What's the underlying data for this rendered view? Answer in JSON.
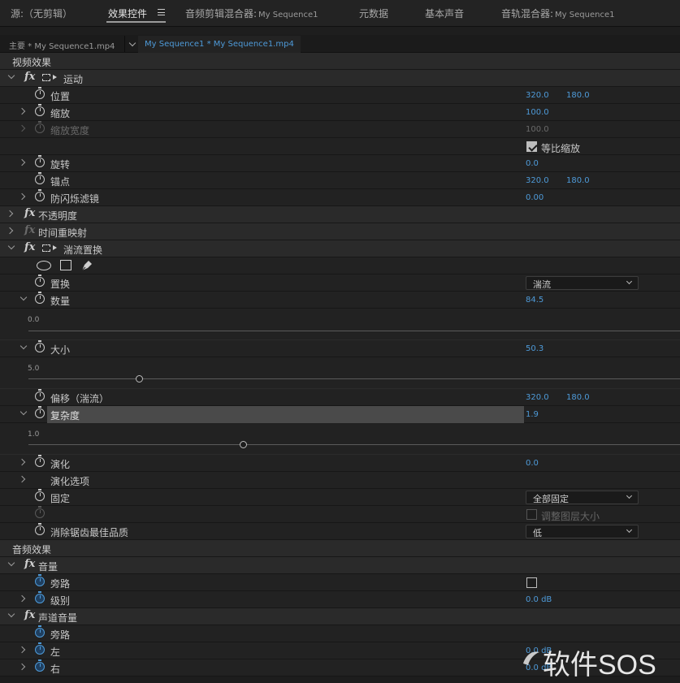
{
  "top_tabs": [
    {
      "label": "源:（无剪辑）",
      "sub": ""
    },
    {
      "label": "效果控件",
      "sub": ""
    },
    {
      "label": "音频剪辑混合器:",
      "sub": "My Sequence1"
    },
    {
      "label": "元数据",
      "sub": ""
    },
    {
      "label": "基本声音",
      "sub": ""
    },
    {
      "label": "音轨混合器:",
      "sub": "My Sequence1"
    }
  ],
  "source_bar": {
    "master": "主要 * My Sequence1.mp4",
    "sequence": "My Sequence1 * My Sequence1.mp4"
  },
  "video_effects": {
    "section": "视频效果",
    "motion": {
      "name": "运动",
      "position": {
        "label": "位置",
        "x": "320.0",
        "y": "180.0"
      },
      "scale": {
        "label": "缩放",
        "value": "100.0"
      },
      "scale_width": {
        "label": "缩放宽度",
        "value": "100.0"
      },
      "uniform": {
        "label": "等比缩放",
        "checked": true
      },
      "rotation": {
        "label": "旋转",
        "value": "0.0"
      },
      "anchor": {
        "label": "锚点",
        "x": "320.0",
        "y": "180.0"
      },
      "flicker": {
        "label": "防闪烁滤镜",
        "value": "0.00"
      }
    },
    "opacity": {
      "name": "不透明度"
    },
    "time_remap": {
      "name": "时间重映射"
    },
    "turbulent": {
      "name": "湍流置换",
      "displacement": {
        "label": "置换",
        "value": "湍流"
      },
      "amount": {
        "label": "数量",
        "value": "84.5",
        "min": "0.0",
        "slider": 1.0
      },
      "size": {
        "label": "大小",
        "value": "50.3",
        "min": "5.0",
        "slider": 0.17
      },
      "offset": {
        "label": "偏移（湍流）",
        "x": "320.0",
        "y": "180.0"
      },
      "complexity": {
        "label": "复杂度",
        "value": "1.9",
        "min": "1.0",
        "slider": 0.33
      },
      "evolution": {
        "label": "演化",
        "value": "0.0"
      },
      "evolution_options": {
        "label": "演化选项"
      },
      "pinning": {
        "label": "固定",
        "value": "全部固定"
      },
      "resize": {
        "label": "调整图层大小",
        "checked": false
      },
      "antialias": {
        "label": "消除锯齿最佳品质",
        "value": "低"
      }
    }
  },
  "audio_effects": {
    "section": "音频效果",
    "volume": {
      "name": "音量",
      "bypass": {
        "label": "旁路",
        "checked": false
      },
      "level": {
        "label": "级别",
        "value": "0.0 dB"
      }
    },
    "channel_volume": {
      "name": "声道音量",
      "bypass": {
        "label": "旁路"
      },
      "left": {
        "label": "左",
        "value": "0.0 dB"
      },
      "right": {
        "label": "右",
        "value": "0.0 dB"
      }
    }
  },
  "watermark": {
    "text": "软件SOS"
  },
  "colors": {
    "accent": "#4e9ad8",
    "bg": "#1d1d1d",
    "header": "#2a2a2a"
  }
}
